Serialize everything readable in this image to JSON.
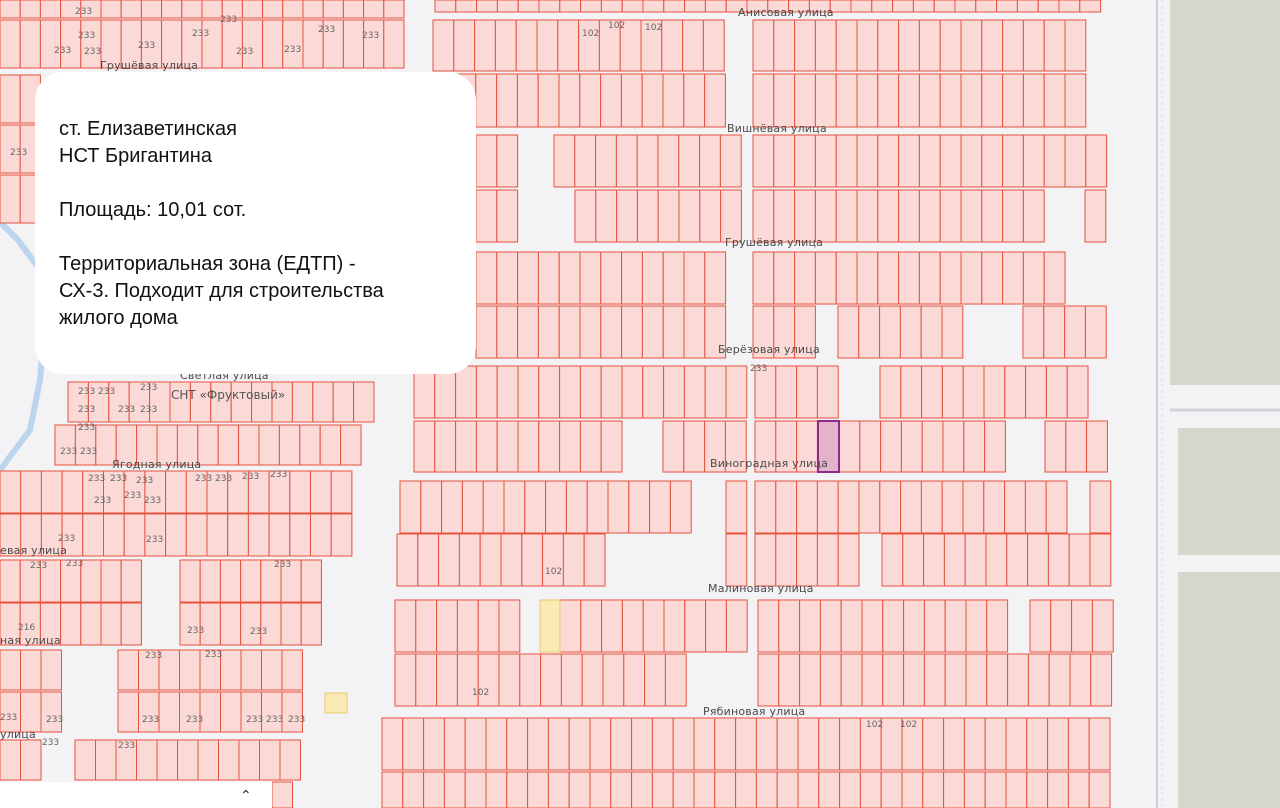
{
  "card": {
    "line1": "ст. Елизаветинская",
    "line2": "НСТ Бригантина",
    "area": "Площадь: 10,01 сот.",
    "zone_line1": "Территориальная зона (ЕДТП) -",
    "zone_line2": "СХ-3. Подходит для строительства",
    "zone_line3": "жилого дома"
  },
  "streets": {
    "anisovaya": "Анисовая улица",
    "vishnevaya": "Вишнёвая улица",
    "grushevaya_main": "Грушёвая улица",
    "grushevaya_left": "Грушёвая улица",
    "berezovaya": "Берёзовая улица",
    "vinogradnaya": "Виноградная улица",
    "malinovaya": "Малиновая улица",
    "ryabinovaya": "Рябиновая улица",
    "yagodnaya": "Ягодная улица",
    "svetlaya": "Светлая улица",
    "left_eva": "евая улица",
    "left_naya": "ная улица",
    "left_litsa": "улица"
  },
  "snt_label": "СНТ «Фруктовый»",
  "zone_codes": {
    "c102": "102",
    "c233": "233",
    "c216": "216"
  },
  "colors": {
    "parcel_fill": "#fbd9d6",
    "parcel_stroke": "#e5533f",
    "selected_fill": "#e2b3cb",
    "selected_stroke": "#8a2a8f",
    "highlight_fill": "#f9ebb3",
    "road": "#f3f2f5",
    "field": "#d7d8cd"
  },
  "icons": {
    "bottom": "chevron-up-down-icon"
  }
}
